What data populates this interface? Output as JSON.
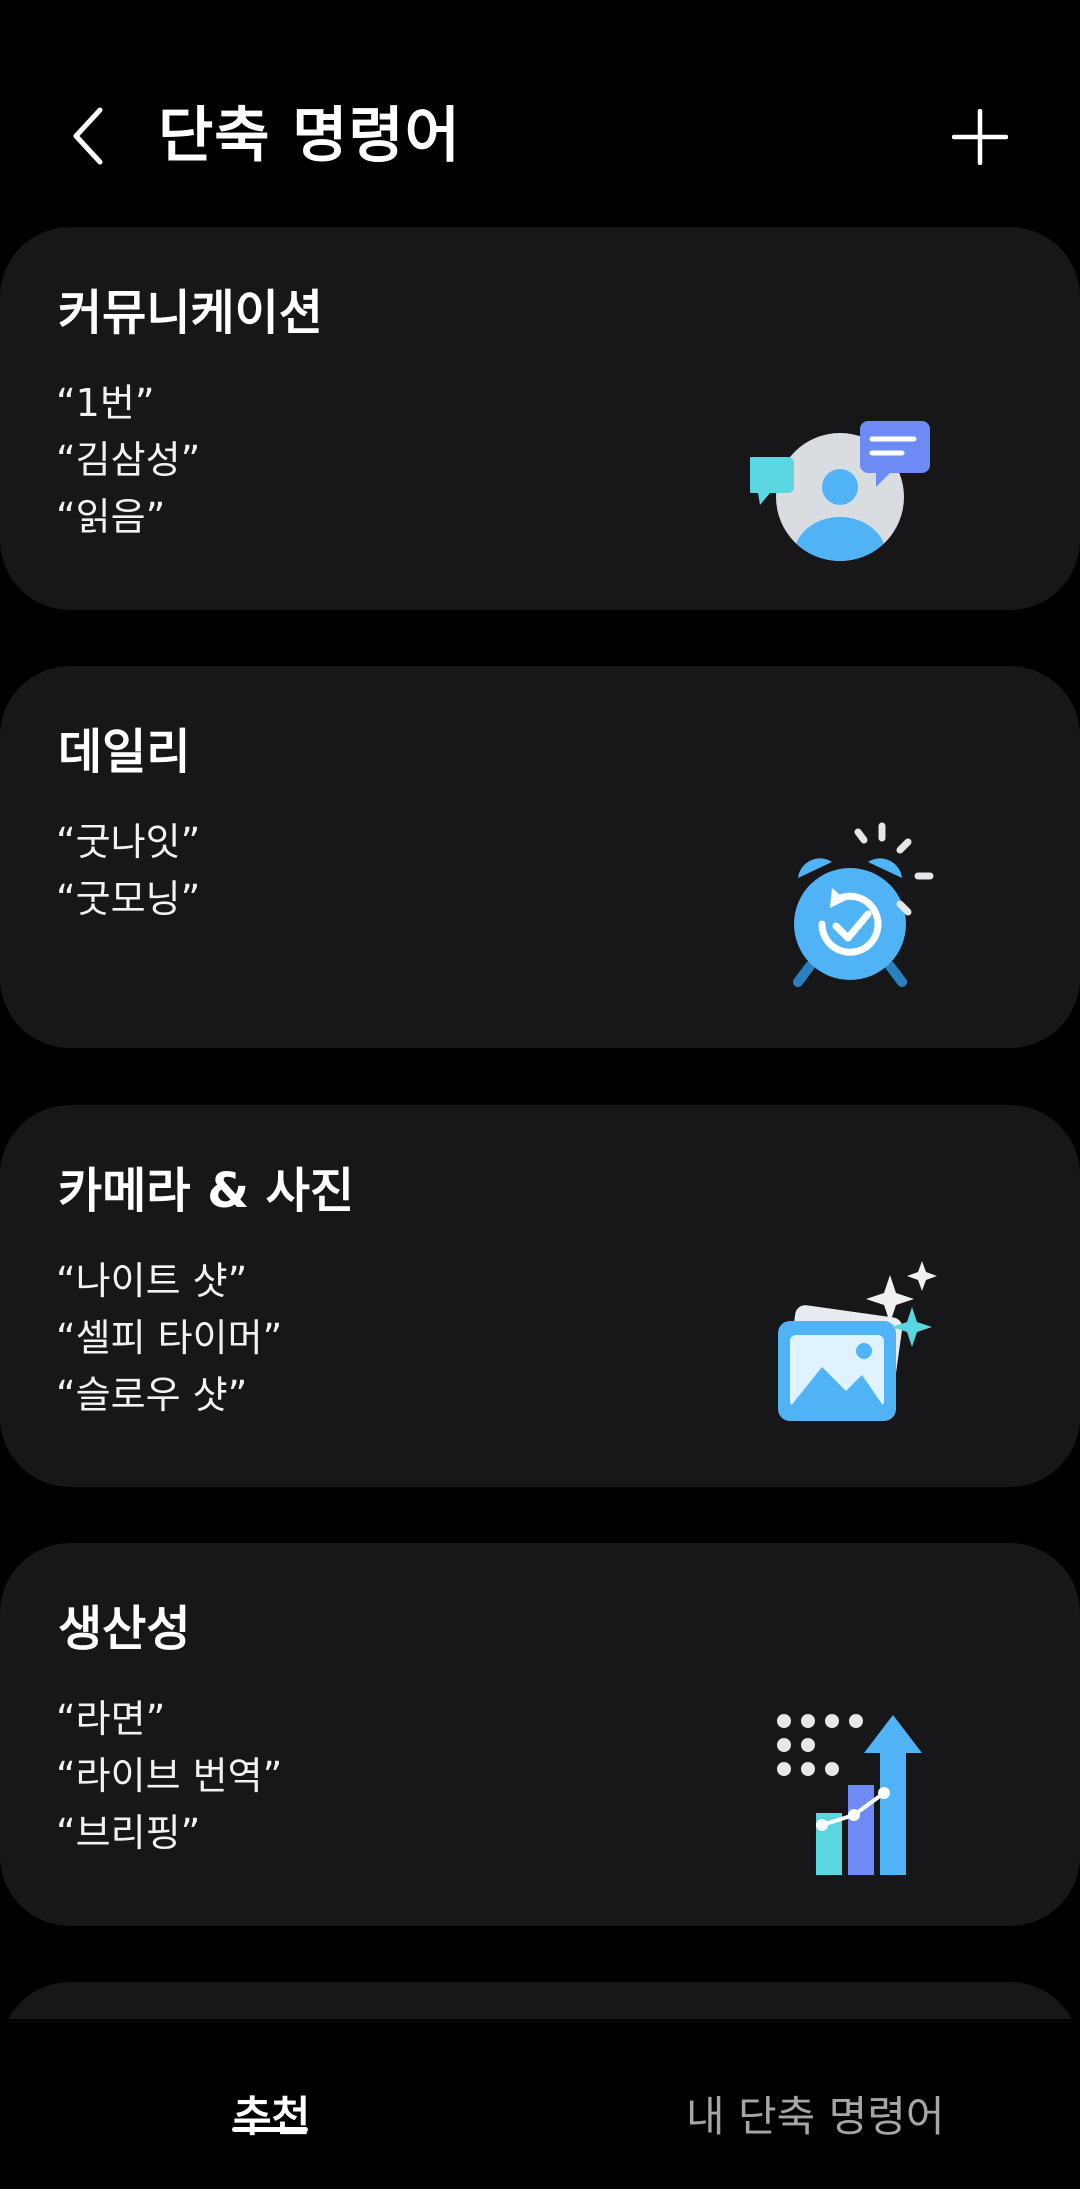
{
  "header": {
    "title": "단축 명령어",
    "back_icon": "chevron-left-icon",
    "add_icon": "plus-icon"
  },
  "cards": [
    {
      "title": "커뮤니케이션",
      "phrases": [
        "“1번”",
        "“김삼성”",
        "“읽음”"
      ],
      "icon": "contact-chat-icon"
    },
    {
      "title": "데일리",
      "phrases": [
        "“굿나잇”",
        "“굿모닝”"
      ],
      "icon": "alarm-clock-icon"
    },
    {
      "title": "카메라 & 사진",
      "phrases": [
        "“나이트 샷”",
        "“셀피 타이머”",
        "“슬로우 샷”"
      ],
      "icon": "photo-sparkle-icon"
    },
    {
      "title": "생산성",
      "phrases": [
        "“라면”",
        "“라이브 번역”",
        "“브리핑”"
      ],
      "icon": "growth-chart-icon"
    }
  ],
  "tabs": {
    "recommend": "추천",
    "mine": "내 단축 명령어"
  },
  "colors": {
    "background": "#000000",
    "card": "#171719",
    "accent_blue": "#4FB3F6",
    "accent_cyan": "#5AD6E0",
    "accent_purple": "#6E8BF5"
  }
}
